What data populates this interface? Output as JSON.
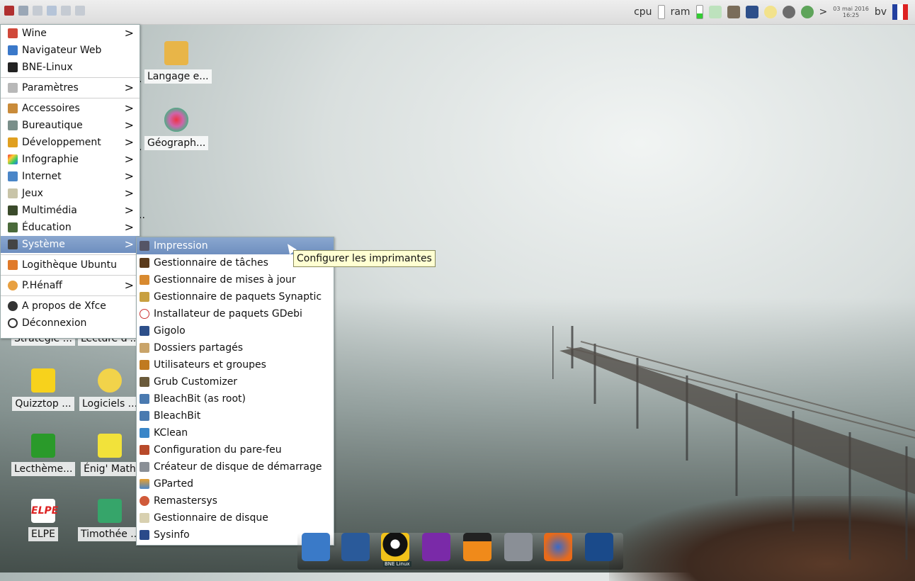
{
  "panel": {
    "cpu_label": "cpu",
    "ram_label": "ram",
    "date_line1": "03 mai 2016",
    "date_line2": "16:25",
    "user": "bv",
    "arrow": ">"
  },
  "menu": {
    "items": [
      {
        "label": "Wine",
        "submenu": true
      },
      {
        "label": "Navigateur Web",
        "submenu": false
      },
      {
        "label": "BNE-Linux",
        "submenu": false
      },
      {
        "label": "Paramètres",
        "submenu": true
      },
      {
        "label": "Accessoires",
        "submenu": true
      },
      {
        "label": "Bureautique",
        "submenu": true
      },
      {
        "label": "Développement",
        "submenu": true
      },
      {
        "label": "Infographie",
        "submenu": true
      },
      {
        "label": "Internet",
        "submenu": true
      },
      {
        "label": "Jeux",
        "submenu": true
      },
      {
        "label": "Multimédia",
        "submenu": true
      },
      {
        "label": "Éducation",
        "submenu": true
      },
      {
        "label": "Système",
        "submenu": true
      },
      {
        "label": "Logithèque Ubuntu",
        "submenu": false
      },
      {
        "label": "P.Hénaff",
        "submenu": true
      },
      {
        "label": "A propos de Xfce",
        "submenu": false
      },
      {
        "label": "Déconnexion",
        "submenu": false
      }
    ],
    "arrow_glyph": ">"
  },
  "submenu": {
    "items": [
      "Impression",
      "Gestionnaire de tâches",
      "Gestionnaire de mises à jour",
      "Gestionnaire de paquets Synaptic",
      "Installateur de paquets GDebi",
      "Gigolo",
      "Dossiers partagés",
      "Utilisateurs et groupes",
      "Grub Customizer",
      "BleachBit (as root)",
      "BleachBit",
      "KClean",
      "Configuration du pare-feu",
      "Créateur de disque de démarrage",
      "GParted",
      "Remastersys",
      "Gestionnaire de disque",
      "Sysinfo"
    ]
  },
  "tooltip": "Configurer les imprimantes",
  "desktop": {
    "icons": [
      "Langage e...",
      "Géograph...",
      "Stratégie ...",
      "Lecture d'...",
      "Quizztop ...",
      "Logiciels ...",
      "Lecthème...",
      "Énig' Math",
      "ELPE",
      "Timothée ..."
    ],
    "fragments": [
      ".",
      ".",
      ".."
    ]
  },
  "dock": {
    "label": "BNE Linux"
  },
  "colors": {
    "selection": "#7b9ac7",
    "tooltip_bg": "#ffffd2"
  }
}
